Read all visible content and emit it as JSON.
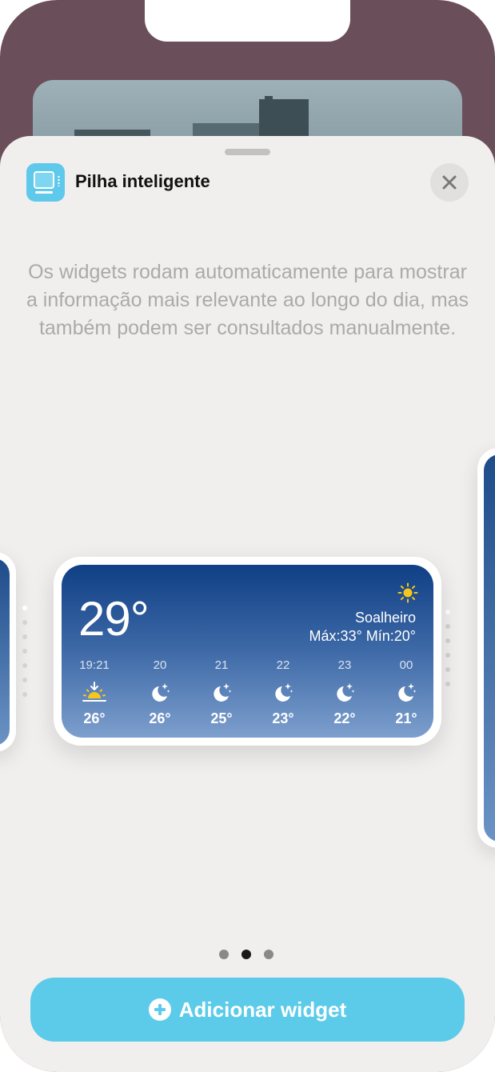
{
  "sheet": {
    "title": "Pilha inteligente",
    "description": "Os widgets rodam automaticamente para mostrar a informação mais relevante ao longo do dia, mas também podem ser consultados manualmente.",
    "app_icon": "smart-stack-icon",
    "close_icon": "close-icon"
  },
  "weather_widget": {
    "current_temp": "29°",
    "condition": "Soalheiro",
    "high_low": "Máx:33° Mín:20°",
    "condition_icon": "sun-icon",
    "hourly": [
      {
        "time": "19:21",
        "icon": "sunset-icon",
        "temp": "26°"
      },
      {
        "time": "20",
        "icon": "moon-stars-icon",
        "temp": "26°"
      },
      {
        "time": "21",
        "icon": "moon-stars-icon",
        "temp": "25°"
      },
      {
        "time": "22",
        "icon": "moon-stars-icon",
        "temp": "23°"
      },
      {
        "time": "23",
        "icon": "moon-stars-icon",
        "temp": "22°"
      },
      {
        "time": "00",
        "icon": "moon-stars-icon",
        "temp": "21°"
      }
    ]
  },
  "pagination": {
    "total": 3,
    "current": 2
  },
  "add_button": {
    "label": "Adicionar widget",
    "icon": "plus-circle-icon"
  },
  "colors": {
    "accent": "#5ccbe9",
    "sheet_background": "#f1efee",
    "widget_top": "#0f3f85",
    "widget_bottom": "#7d9fcd",
    "sun": "#f7c61a"
  }
}
